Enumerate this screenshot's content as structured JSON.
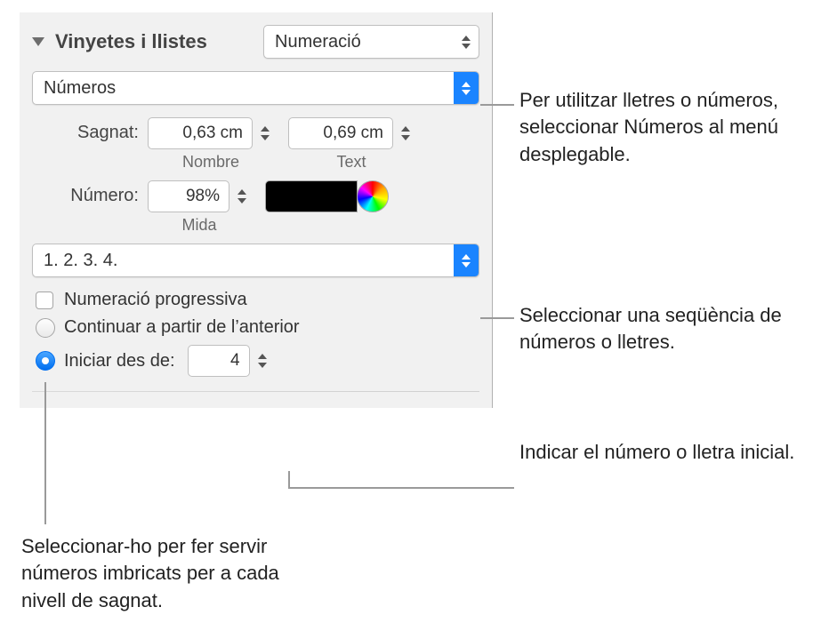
{
  "section": {
    "title": "Vinyetes i llistes"
  },
  "listType": {
    "value": "Numeració"
  },
  "numberStyle": {
    "value": "Números"
  },
  "indent": {
    "label": "Sagnat:",
    "number": {
      "value": "0,63 cm",
      "sub": "Nombre"
    },
    "text": {
      "value": "0,69 cm",
      "sub": "Text"
    }
  },
  "size": {
    "label": "Número:",
    "value": "98%",
    "sub": "Mida"
  },
  "sequence": {
    "value": "1. 2. 3. 4."
  },
  "progressive": {
    "label": "Numeració progressiva"
  },
  "continue": {
    "label": "Continuar a partir de l’anterior"
  },
  "startFrom": {
    "label": "Iniciar des de:",
    "value": "4"
  },
  "callouts": {
    "c1": "Per utilitzar lletres o números, seleccionar Números al menú desplegable.",
    "c2": "Seleccionar una seqüència de números o lletres.",
    "c3": "Indicar el número o lletra inicial.",
    "c4": "Seleccionar-ho per fer servir números imbricats per a cada nivell de sagnat."
  }
}
